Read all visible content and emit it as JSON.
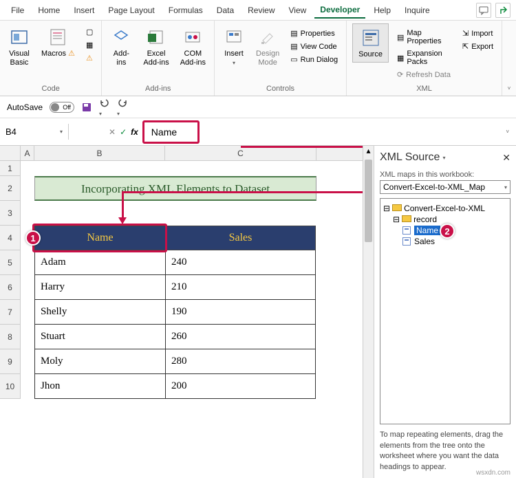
{
  "menubar": {
    "items": [
      "File",
      "Home",
      "Insert",
      "Page Layout",
      "Formulas",
      "Data",
      "Review",
      "View",
      "Developer",
      "Help",
      "Inquire"
    ],
    "active": "Developer"
  },
  "ribbon": {
    "code": {
      "label": "Code",
      "visual_basic": "Visual\nBasic",
      "macros": "Macros"
    },
    "addins": {
      "label": "Add-ins",
      "addins": "Add-\nins",
      "excel_addins": "Excel\nAdd-ins",
      "com_addins": "COM\nAdd-ins"
    },
    "controls": {
      "label": "Controls",
      "insert": "Insert",
      "design_mode": "Design\nMode",
      "properties": "Properties",
      "view_code": "View Code",
      "run_dialog": "Run Dialog"
    },
    "xml": {
      "label": "XML",
      "source": "Source",
      "map_properties": "Map Properties",
      "expansion_packs": "Expansion Packs",
      "refresh_data": "Refresh Data",
      "import": "Import",
      "export": "Export"
    }
  },
  "qat": {
    "autosave": "AutoSave",
    "autosave_state": "Off"
  },
  "namebox": {
    "cell_ref": "B4",
    "formula_value": "Name"
  },
  "sheet": {
    "cols": [
      "A",
      "B",
      "C"
    ],
    "rows": [
      "1",
      "2",
      "3",
      "4",
      "5",
      "6",
      "7",
      "8",
      "9",
      "10"
    ],
    "title": "Incorporating XML Elements to Dataset",
    "headers": {
      "name": "Name",
      "sales": "Sales"
    },
    "data": [
      {
        "name": "Adam",
        "sales": "240"
      },
      {
        "name": "Harry",
        "sales": "210"
      },
      {
        "name": "Shelly",
        "sales": "190"
      },
      {
        "name": "Stuart",
        "sales": "260"
      },
      {
        "name": "Moly",
        "sales": "280"
      },
      {
        "name": "Jhon",
        "sales": "200"
      }
    ]
  },
  "xml_pane": {
    "title": "XML Source",
    "maps_label": "XML maps in this workbook:",
    "selected_map": "Convert-Excel-to-XML_Map",
    "root": "Convert-Excel-to-XML",
    "record": "record",
    "name": "Name",
    "sales": "Sales",
    "hint": "To map repeating elements, drag the elements from the tree onto the worksheet where you want the data headings to appear."
  },
  "callouts": {
    "one": "1",
    "two": "2"
  },
  "watermark": "wsxdn.com"
}
